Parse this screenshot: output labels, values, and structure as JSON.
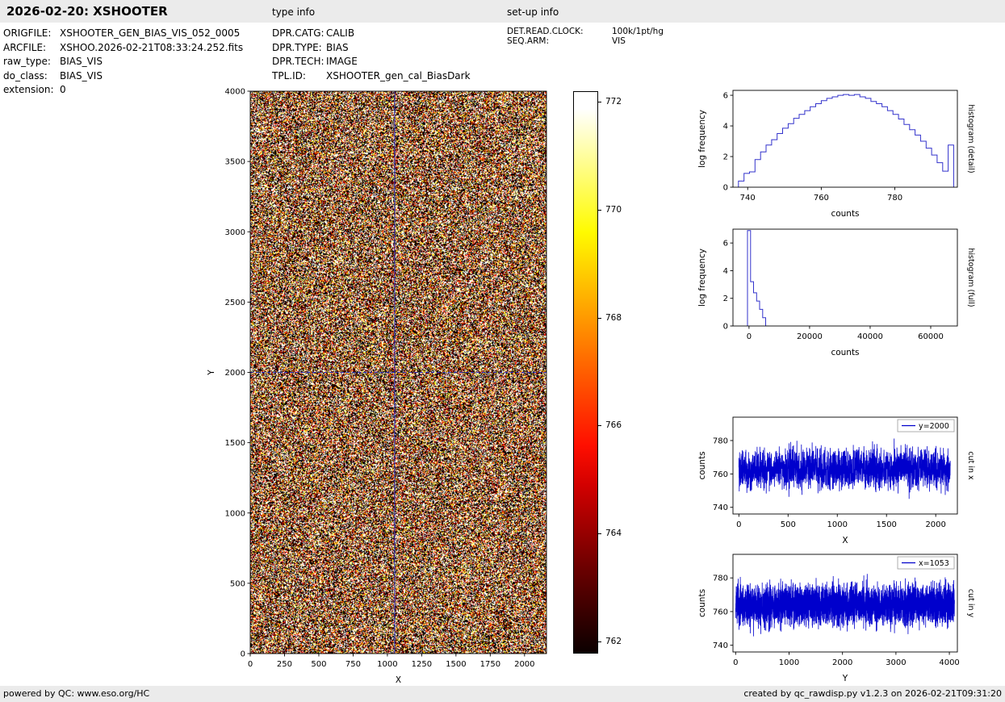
{
  "header": {
    "title": "2026-02-20: XSHOOTER",
    "type_info_label": "type info",
    "setup_info_label": "set-up info"
  },
  "file_info": {
    "rows": [
      {
        "label": "ORIGFILE:",
        "value": "XSHOOTER_GEN_BIAS_VIS_052_0005"
      },
      {
        "label": "ARCFILE:",
        "value": "XSHOO.2026-02-21T08:33:24.252.fits"
      },
      {
        "label": "raw_type:",
        "value": "BIAS_VIS"
      },
      {
        "label": "do_class:",
        "value": "BIAS_VIS"
      },
      {
        "label": "extension:",
        "value": "0"
      }
    ]
  },
  "type_info": {
    "rows": [
      {
        "label": "DPR.CATG:",
        "value": "CALIB"
      },
      {
        "label": "DPR.TYPE:",
        "value": "BIAS"
      },
      {
        "label": "DPR.TECH:",
        "value": "IMAGE"
      },
      {
        "label": "TPL.ID:",
        "value": "XSHOOTER_gen_cal_BiasDark"
      }
    ]
  },
  "setup_info": {
    "rows": [
      {
        "label": "DET.READ.CLOCK:",
        "value": "100k/1pt/hg"
      },
      {
        "label": "SEQ.ARM:",
        "value": "VIS"
      }
    ]
  },
  "footer": {
    "left": "powered by QC: www.eso.org/HC",
    "right": "created by qc_rawdisp.py v1.2.3 on 2026-02-21T09:31:20"
  },
  "chart_data": [
    {
      "id": "main-image",
      "type": "heatmap",
      "title": "",
      "xlabel": "X",
      "ylabel": "Y",
      "xlim": [
        0,
        2160
      ],
      "ylim": [
        0,
        4000
      ],
      "xticks": [
        0,
        250,
        500,
        750,
        1000,
        1250,
        1500,
        1750,
        2000
      ],
      "yticks": [
        0,
        500,
        1000,
        1500,
        2000,
        2500,
        3000,
        3500,
        4000
      ],
      "clim": [
        761.8,
        772.2
      ],
      "colormap": "hot",
      "noise": {
        "mean": 766,
        "sigma": 9,
        "seed": 42
      },
      "crosshair": {
        "x": 1053,
        "y": 2000,
        "color": "#2a2ab8"
      }
    },
    {
      "id": "colorbar",
      "type": "colorbar",
      "range": [
        761.8,
        772.2
      ],
      "ticks": [
        762,
        764,
        766,
        768,
        770,
        772
      ],
      "colormap": "hot"
    },
    {
      "id": "hist-detail",
      "type": "step-line",
      "color": "#3333cc",
      "xlabel": "counts",
      "ylabel": "log frequency",
      "right_label": "histogram (detail)",
      "xlim": [
        736,
        797
      ],
      "ylim": [
        0,
        6.32
      ],
      "xticks": [
        740,
        760,
        780
      ],
      "yticks": [
        0,
        2,
        4,
        6
      ],
      "x": [
        737.5,
        739,
        740.5,
        742,
        743.5,
        745,
        746.5,
        748,
        749.5,
        751,
        752.5,
        754,
        755.5,
        757,
        758.5,
        760,
        761.5,
        763,
        764.5,
        766,
        767.5,
        769,
        770.5,
        772,
        773.5,
        775,
        776.5,
        778,
        779.5,
        781,
        782.5,
        784,
        785.5,
        787,
        788.5,
        790,
        791.5,
        793,
        794.5
      ],
      "y": [
        0.4,
        0.9,
        1.0,
        1.8,
        2.3,
        2.75,
        3.1,
        3.5,
        3.85,
        4.15,
        4.5,
        4.75,
        5.0,
        5.25,
        5.45,
        5.65,
        5.8,
        5.9,
        6.0,
        6.05,
        6.0,
        6.05,
        5.9,
        5.8,
        5.6,
        5.45,
        5.25,
        5.0,
        4.75,
        4.45,
        4.1,
        3.75,
        3.4,
        3.0,
        2.55,
        2.1,
        1.6,
        1.05,
        2.75
      ]
    },
    {
      "id": "hist-full",
      "type": "step-line",
      "color": "#3333cc",
      "xlabel": "counts",
      "ylabel": "log frequency",
      "right_label": "histogram (full)",
      "xlim": [
        -5300,
        68800
      ],
      "ylim": [
        0,
        7.0
      ],
      "xticks": [
        0,
        20000,
        40000,
        60000
      ],
      "yticks": [
        0,
        2,
        4,
        6
      ],
      "x": [
        -500,
        500,
        1500,
        2500,
        3500,
        4500,
        5500
      ],
      "y": [
        6.9,
        3.2,
        2.4,
        1.8,
        1.2,
        0.6,
        0.0
      ]
    },
    {
      "id": "cut-x",
      "type": "noise-line",
      "color": "#0000cc",
      "xlabel": "X",
      "ylabel": "counts",
      "right_label": "cut in x",
      "legend": "y=2000",
      "xlim": [
        -60,
        2220
      ],
      "ylim": [
        736,
        794
      ],
      "xticks": [
        0,
        500,
        1000,
        1500,
        2000
      ],
      "yticks": [
        740,
        760,
        780
      ],
      "noise": {
        "n": 2148,
        "x0": 0,
        "x1": 2148,
        "mean": 763,
        "sigma": 6,
        "seed": 101
      }
    },
    {
      "id": "cut-y",
      "type": "noise-line",
      "color": "#0000cc",
      "xlabel": "Y",
      "ylabel": "counts",
      "right_label": "cut in y",
      "legend": "x=1053",
      "xlim": [
        -50,
        4150
      ],
      "ylim": [
        736,
        794
      ],
      "xticks": [
        0,
        1000,
        2000,
        3000,
        4000
      ],
      "yticks": [
        740,
        760,
        780
      ],
      "noise": {
        "n": 4096,
        "x0": 0,
        "x1": 4096,
        "mean": 764,
        "sigma": 6,
        "seed": 202
      }
    }
  ]
}
